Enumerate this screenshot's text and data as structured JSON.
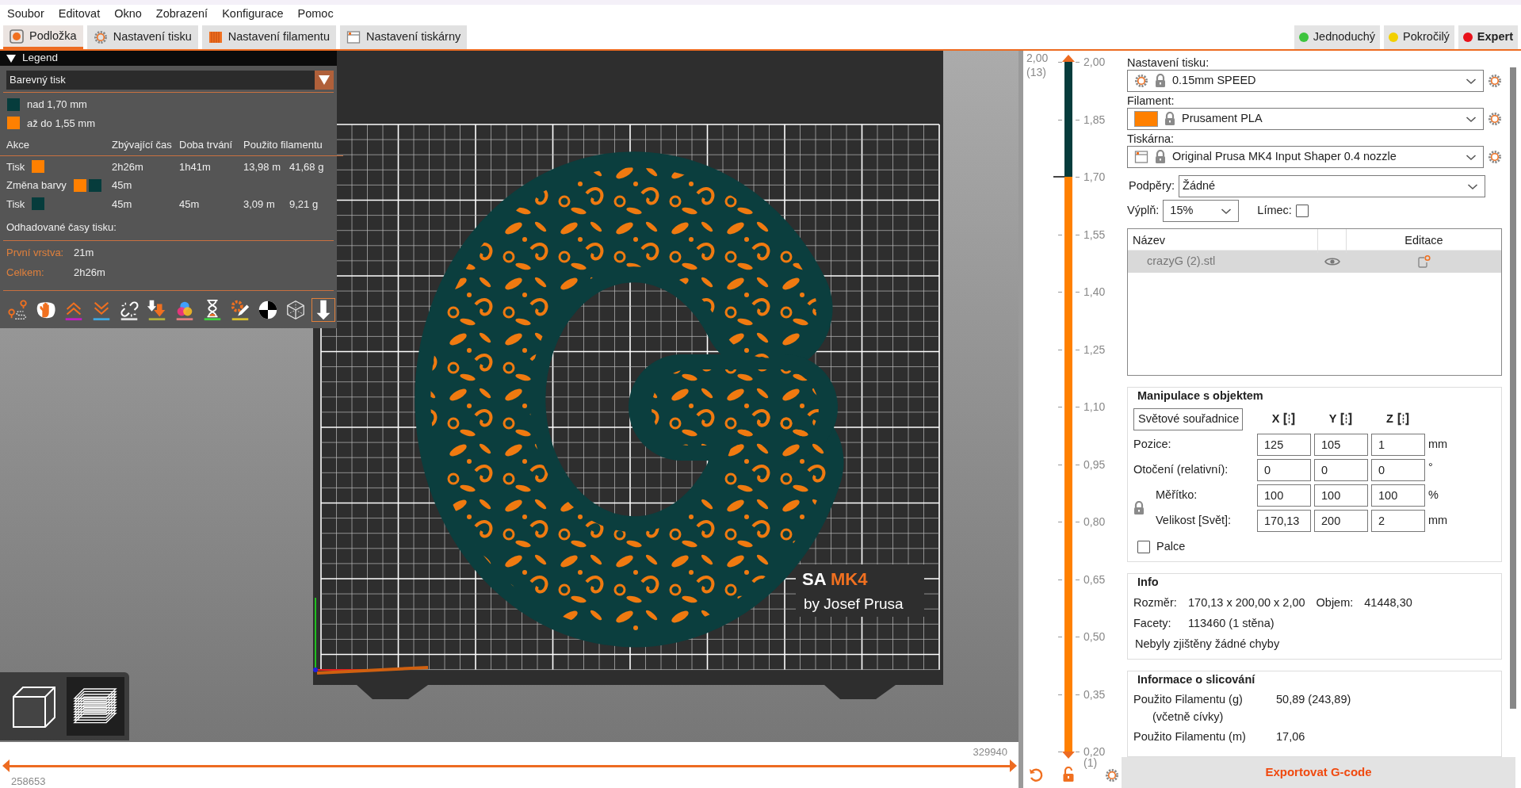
{
  "menu": [
    "Soubor",
    "Editovat",
    "Okno",
    "Zobrazení",
    "Konfigurace",
    "Pomoc"
  ],
  "tabs": [
    {
      "kind": "plater",
      "label": "Podložka",
      "selected": true
    },
    {
      "kind": "print",
      "label": "Nastavení tisku",
      "selected": false
    },
    {
      "kind": "filament",
      "label": "Nastavení filamentu",
      "selected": false
    },
    {
      "kind": "printer",
      "label": "Nastavení tiskárny",
      "selected": false
    }
  ],
  "modes": [
    {
      "label": "Jednoduchý",
      "color": "#3ec43e",
      "selected": false
    },
    {
      "label": "Pokročilý",
      "color": "#f2d000",
      "selected": false
    },
    {
      "label": "Expert",
      "color": "#e8111a",
      "selected": true
    }
  ],
  "legend": {
    "title": "Legend",
    "expanded": true,
    "view_type": "Barevný tisk",
    "ranges": [
      {
        "color": "#063c3c",
        "label": "nad 1,70 mm"
      },
      {
        "color": "#ff8000",
        "label": "až do 1,55 mm"
      }
    ],
    "columns": [
      "Akce",
      "Zbývající čas",
      "Doba trvání",
      "Použito filamentu"
    ],
    "rows": [
      {
        "action": "Tisk",
        "swatches": [
          {
            "color": "#ff8000"
          }
        ],
        "remaining": "2h26m",
        "duration": "1h41m",
        "length": "13,98 m",
        "weight": "41,68 g"
      },
      {
        "action": "Změna barvy",
        "swatches": [
          {
            "color": "#ff8000"
          },
          {
            "color": "#063c3c"
          }
        ],
        "remaining": "45m"
      },
      {
        "action": "Tisk",
        "swatches": [
          {
            "color": "#063c3c"
          }
        ],
        "remaining": "45m",
        "duration": "45m",
        "length": "3,09 m",
        "weight": "9,21 g"
      }
    ],
    "estimated_title": "Odhadované časy tisku:",
    "times": [
      {
        "label": "První vrstva:",
        "value": "21m"
      },
      {
        "label": "Celkem:",
        "value": "2h26m"
      }
    ],
    "toolbar": [
      {
        "kind": "travel",
        "selected": false
      },
      {
        "kind": "wipe",
        "selected": false
      },
      {
        "kind": "retractions",
        "selected": false
      },
      {
        "kind": "deretractions",
        "selected": false
      },
      {
        "kind": "seams",
        "selected": false
      },
      {
        "kind": "tool_changes",
        "selected": false
      },
      {
        "kind": "color_changes",
        "selected": false
      },
      {
        "kind": "pause_prints",
        "selected": false
      },
      {
        "kind": "custom_gcodes",
        "selected": false
      },
      {
        "kind": "center_of_gravity",
        "selected": false
      },
      {
        "kind": "shells",
        "selected": false
      },
      {
        "kind": "tool_marker",
        "selected": true
      }
    ]
  },
  "viewport": {
    "bed_label": "SA",
    "bed_model": "MK4",
    "bed_maker": "by Josef Prusa"
  },
  "view_buttons": [
    {
      "kind": "model",
      "selected": false
    },
    {
      "kind": "preview",
      "selected": true
    }
  ],
  "horizontal_slider": {
    "max_label": "329940",
    "min_label": "258653",
    "thumbs": [
      {
        "level": 0
      },
      {
        "level": 1
      }
    ]
  },
  "vertical_slider": {
    "top_value": "2,00",
    "top_layer": "(13)",
    "bottom_layer": "(1)",
    "ticks": [
      {
        "label": "2,00",
        "color_change": false
      },
      {
        "label": "1,85",
        "color_change": false
      },
      {
        "label": "1,70",
        "color_change": true
      },
      {
        "label": "1,55",
        "color_change": false
      },
      {
        "label": "1,40",
        "color_change": false
      },
      {
        "label": "1,25",
        "color_change": false
      },
      {
        "label": "1,10",
        "color_change": false
      },
      {
        "label": "0,95",
        "color_change": false
      },
      {
        "label": "0,80",
        "color_change": false
      },
      {
        "label": "0,65",
        "color_change": false
      },
      {
        "label": "0,50",
        "color_change": false
      },
      {
        "label": "0,35",
        "color_change": false
      },
      {
        "label": "0,20",
        "color_change": false
      }
    ],
    "thumbs": [
      {
        "level": 1
      },
      {
        "level": 0
      }
    ]
  },
  "presets": [
    {
      "kind": "print",
      "label": "Nastavení tisku:",
      "value": "0.15mm SPEED"
    },
    {
      "kind": "filament",
      "label": "Filament:",
      "value": "Prusament PLA",
      "color": "#ff8000"
    },
    {
      "kind": "printer",
      "label": "Tiskárna:",
      "value": "Original Prusa MK4 Input Shaper 0.4 nozzle"
    }
  ],
  "supports": {
    "label": "Podpěry:",
    "value": "Žádné"
  },
  "infill": {
    "label": "Výplň:",
    "value": "15%"
  },
  "brim": {
    "label": "Límec:",
    "checked": false
  },
  "objects": {
    "columns": [
      "Název",
      "Editace"
    ],
    "rows": [
      {
        "name": "crazyG (2).stl",
        "selected": true,
        "visible": true
      }
    ]
  },
  "manipulation": {
    "title": "Manipulace s objektem",
    "coordinates": "Světové souřadnice",
    "axes": [
      "X",
      "Y",
      "Z"
    ],
    "rows": [
      {
        "label": "Pozice:",
        "values": [
          "125",
          "105",
          "1"
        ],
        "unit": "mm"
      },
      {
        "label": "Otočení (relativní):",
        "values": [
          "0",
          "0",
          "0"
        ],
        "unit": "°"
      },
      {
        "label": "Měřítko:",
        "values": [
          "100",
          "100",
          "100"
        ],
        "unit": "%"
      },
      {
        "label": "Velikost [Svět]:",
        "values": [
          "170,13",
          "200",
          "2"
        ],
        "unit": "mm"
      }
    ],
    "inches": {
      "label": "Palce",
      "checked": false
    }
  },
  "info": {
    "title": "Info",
    "size_label": "Rozměr:",
    "size": "170,13 x 200,00 x 2,00",
    "volume_label": "Objem:",
    "volume": "41448,30",
    "facets_label": "Facety:",
    "facets": "113460 (1 stěna)",
    "status": "Nebyly zjištěny žádné chyby"
  },
  "slicing": {
    "title": "Informace o slicování",
    "rows": [
      {
        "label": "Použito Filamentu (g)",
        "sublabel": "(včetně cívky)",
        "value": "50,89 (243,89)"
      },
      {
        "label": "Použito Filamentu (m)",
        "value": "17,06"
      }
    ]
  },
  "export": "Exportovat G-code"
}
